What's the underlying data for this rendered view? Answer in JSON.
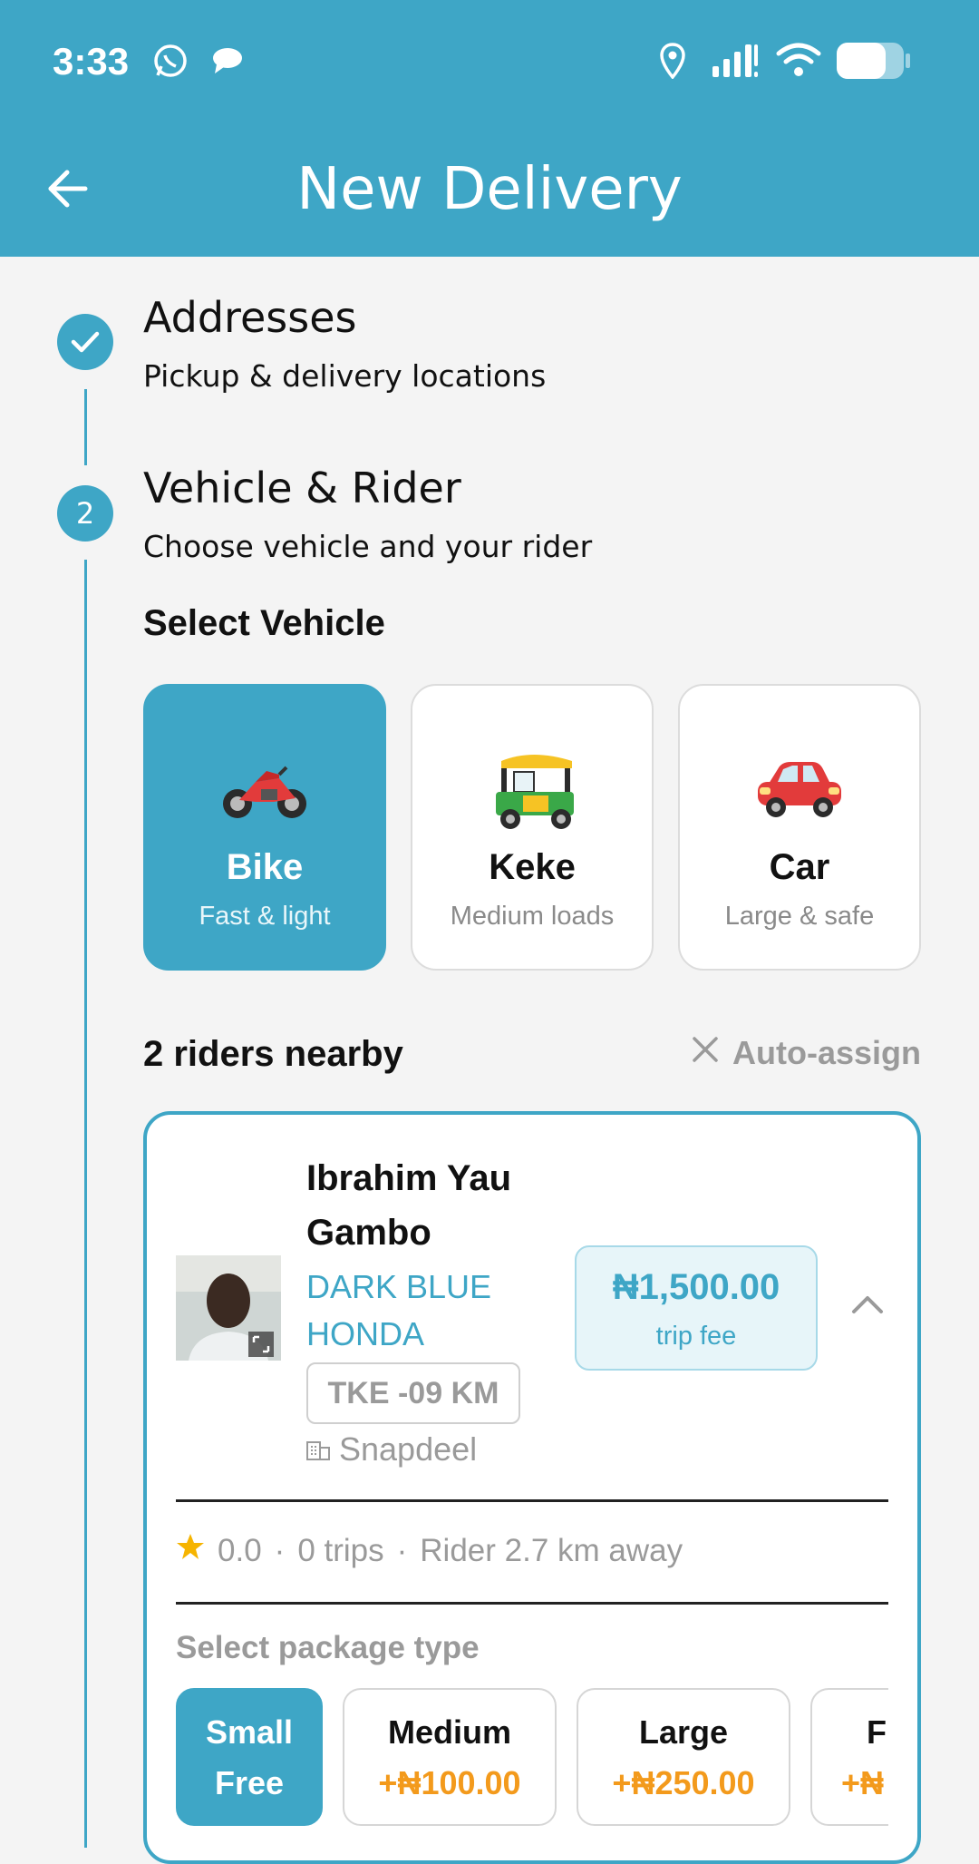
{
  "status_bar": {
    "time": "3:33"
  },
  "header": {
    "title": "New Delivery"
  },
  "steps": [
    {
      "number": "",
      "title": "Addresses",
      "subtitle": "Pickup & delivery locations",
      "state": "done"
    },
    {
      "number": "2",
      "title": "Vehicle & Rider",
      "subtitle": "Choose vehicle and your rider",
      "state": "active"
    }
  ],
  "vehicle_section": {
    "title": "Select Vehicle"
  },
  "vehicles": [
    {
      "name": "Bike",
      "subtitle": "Fast & light",
      "icon": "motorcycle-icon",
      "selected": true
    },
    {
      "name": "Keke",
      "subtitle": "Medium loads",
      "icon": "auto-rickshaw-icon",
      "selected": false
    },
    {
      "name": "Car",
      "subtitle": "Large & safe",
      "icon": "car-icon",
      "selected": false
    }
  ],
  "riders": {
    "count_label": "2 riders nearby",
    "auto_assign_label": "Auto-assign"
  },
  "rider": {
    "name": "Ibrahim Yau Gambo",
    "vehicle": "DARK BLUE HONDA",
    "plate": "TKE -09 KM",
    "company": "Snapdeel",
    "fee": "₦1,500.00",
    "fee_label": "trip fee",
    "rating": "0.0",
    "trips": "0 trips",
    "distance": "Rider 2.7 km away"
  },
  "package": {
    "title": "Select package type",
    "options": [
      {
        "name": "Small",
        "price": "Free",
        "selected": true
      },
      {
        "name": "Medium",
        "price": "+₦100.00",
        "selected": false
      },
      {
        "name": "Large",
        "price": "+₦250.00",
        "selected": false
      },
      {
        "name": "Fr",
        "price": "+₦",
        "selected": false
      }
    ]
  },
  "colors": {
    "primary": "#3ea6c6",
    "accent_orange": "#f39a1c",
    "muted": "#9a9a9a"
  }
}
